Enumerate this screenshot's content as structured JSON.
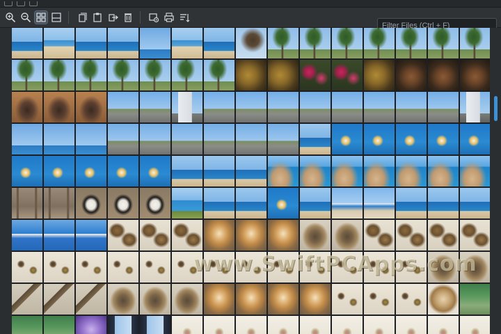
{
  "toolbar": {
    "filter_placeholder": "Filter Files (Ctrl + F)",
    "buttons": [
      {
        "icon": "zoom-in-icon"
      },
      {
        "icon": "zoom-out-icon"
      },
      {
        "icon": "grid-view-icon",
        "active": true
      },
      {
        "icon": "split-view-icon"
      },
      {
        "icon": "copy-icon"
      },
      {
        "icon": "paste-icon"
      },
      {
        "icon": "move-icon"
      },
      {
        "icon": "delete-icon"
      },
      {
        "icon": "gallery-settings-icon"
      },
      {
        "icon": "print-icon"
      },
      {
        "icon": "sort-icon"
      }
    ]
  },
  "watermark": "www.SwiftPCApps.com",
  "accent_color": "#3d8fd6",
  "thumbnails": [
    [
      "sea",
      "beach",
      "sea",
      "sea",
      "sky",
      "beach",
      "sea",
      "tree",
      "palm",
      "palm",
      "palm",
      "palm",
      "palm",
      "palm",
      "palm"
    ],
    [
      "palm",
      "palm",
      "palm",
      "palm",
      "palm",
      "palm",
      "palm",
      "bush",
      "bush",
      "flower",
      "flower",
      "bush",
      "dark",
      "dark",
      "dark"
    ],
    [
      "rock",
      "rock",
      "rock",
      "road",
      "road",
      "hotel",
      "road",
      "road",
      "road",
      "road",
      "road",
      "road",
      "road",
      "road",
      "hotel"
    ],
    [
      "sky",
      "sky",
      "sky",
      "road",
      "road",
      "road",
      "road",
      "road",
      "road",
      "sea",
      "boat",
      "boat",
      "boat",
      "boat",
      "boat"
    ],
    [
      "boat",
      "boat",
      "boat",
      "boat",
      "boat",
      "sea",
      "sea",
      "sea",
      "rocky",
      "rocky",
      "rocky",
      "rocky",
      "rocky",
      "rocky",
      "rocky"
    ],
    [
      "bench",
      "bench",
      "cat",
      "cat",
      "cat",
      "coast",
      "sea",
      "sea",
      "boat",
      "sea",
      "house",
      "house",
      "sea",
      "sea",
      "sea"
    ],
    [
      "harbor",
      "harbor",
      "harbor",
      "moth",
      "moth",
      "moth",
      "fox",
      "fox",
      "fox",
      "bird",
      "bird",
      "moth",
      "moth",
      "moth",
      "moth"
    ],
    [
      "insect",
      "insect",
      "insect",
      "insect",
      "insect",
      "insect",
      "insect",
      "insect",
      "insect",
      "insect",
      "insect",
      "insect",
      "insect",
      "bird",
      "bird"
    ],
    [
      "branch",
      "branch",
      "branch",
      "bird",
      "bird",
      "bird",
      "fox",
      "fox",
      "fox",
      "fox",
      "insect",
      "insect",
      "insect",
      "coral",
      "green"
    ],
    [
      "green",
      "green",
      "purple",
      "window",
      "window",
      "paper",
      "paper",
      "paper",
      "paper",
      "paper",
      "paper",
      "paper",
      "paper",
      "paper",
      "paper"
    ]
  ]
}
